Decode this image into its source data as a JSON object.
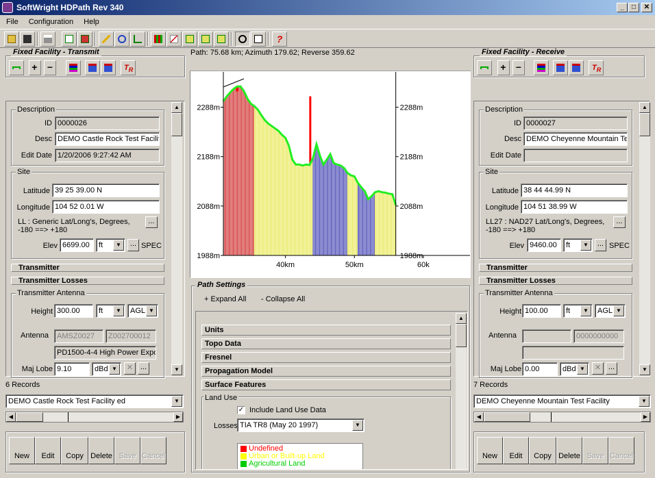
{
  "window": {
    "title": "SoftWright HDPath Rev 340"
  },
  "menu": [
    "File",
    "Configuration",
    "Help"
  ],
  "path_info": "Path: 75.68 km; Azimuth 179.62; Reverse 359.62",
  "left": {
    "frame_title": "Fixed Facility - Transmit",
    "description": {
      "label": "Description",
      "id_label": "ID",
      "id": "0000026",
      "desc_label": "Desc",
      "desc": "DEMO Castle Rock Test Facilit",
      "edit_label": "Edit Date",
      "edit_date": "1/20/2006 9:27:42 AM"
    },
    "site": {
      "label": "Site",
      "lat_label": "Latitude",
      "lat": "39 25 39.00 N",
      "lon_label": "Longitude",
      "lon": "104 52 0.01 W",
      "datum": "LL : Generic Lat/Long's, Degrees, -180 ==> +180",
      "elev_label": "Elev",
      "elev": "6699.00",
      "elev_unit": "ft",
      "spec": "SPEC"
    },
    "transmitter": "Transmitter",
    "losses": "Transmitter Losses",
    "antenna": {
      "label": "Transmitter Antenna",
      "height_label": "Height",
      "height": "300.00",
      "height_unit": "ft",
      "height_ref": "AGL",
      "ant_label": "Antenna",
      "ant1": "AMSZ0027",
      "ant2": "Z002700012",
      "ant_desc": "PD1500-4-4 High Power Expo",
      "lobe_label": "Maj Lobe",
      "lobe": "9.10",
      "lobe_unit": "dBd"
    },
    "records": "6 Records",
    "record_select": "DEMO Castle Rock Test Facility ed"
  },
  "right": {
    "frame_title": "Fixed Facility - Receive",
    "description": {
      "label": "Description",
      "id_label": "ID",
      "id": "0000027",
      "desc_label": "Desc",
      "desc": "DEMO Cheyenne Mountain Te",
      "edit_label": "Edit Date",
      "edit_date": ""
    },
    "site": {
      "label": "Site",
      "lat_label": "Latitude",
      "lat": "38 44 44.99 N",
      "lon_label": "Longitude",
      "lon": "104 51 38.99 W",
      "datum": "LL27 : NAD27 Lat/Long's, Degrees, -180 ==> +180",
      "elev_label": "Elev",
      "elev": "9460.00",
      "elev_unit": "ft",
      "spec": "SPEC"
    },
    "transmitter": "Transmitter",
    "losses": "Transmitter Losses",
    "antenna": {
      "label": "Transmitter Antenna",
      "height_label": "Height",
      "height": "100.00",
      "height_unit": "ft",
      "height_ref": "AGL",
      "ant_label": "Antenna",
      "ant1": "",
      "ant2": "0000000000",
      "ant_desc": "",
      "lobe_label": "Maj Lobe",
      "lobe": "0.00",
      "lobe_unit": "dBd"
    },
    "records": "7 Records",
    "record_select": "DEMO Cheyenne Mountain Test Facility"
  },
  "buttons": {
    "new": "New",
    "edit": "Edit",
    "copy": "Copy",
    "delete": "Delete",
    "save": "Save",
    "cancel": "Cancel"
  },
  "path_settings": {
    "title": "Path Settings",
    "expand": "+ Expand All",
    "collapse": "- Collapse All",
    "sections": [
      "Units",
      "Topo Data",
      "Fresnel",
      "Propagation Model",
      "Surface Features"
    ],
    "land_use_label": "Land Use",
    "include_label": "Include Land Use Data",
    "losses_label": "Losses",
    "losses_value": "TIA TR8 (May 20 1997)",
    "legend": [
      {
        "label": "Undefined",
        "color": "#ff0000"
      },
      {
        "label": "Urban or Built-up Land",
        "color": "#ffff00"
      },
      {
        "label": "Agricultural Land",
        "color": "#00cc00"
      }
    ]
  },
  "chart_data": {
    "type": "area",
    "y_ticks": [
      "2288m",
      "2188m",
      "2088m",
      "1988m"
    ],
    "y_tick_values": [
      2288,
      2188,
      2088,
      1988
    ],
    "x_ticks": [
      "40km",
      "50km",
      "60k"
    ],
    "x_tick_values": [
      40,
      50,
      60
    ],
    "xlim": [
      31,
      61
    ],
    "ylim": [
      1988,
      2340
    ],
    "path_end_km": 56,
    "profile": {
      "x": [
        31,
        31.5,
        32,
        32.5,
        33,
        33.5,
        34,
        34.5,
        35,
        35.5,
        36,
        36.5,
        37,
        37.5,
        38,
        38.5,
        39,
        39.5,
        40,
        40.5,
        41,
        41.5,
        42,
        42.5,
        43,
        43.5,
        44,
        44.5,
        45,
        45.5,
        46,
        46.5,
        47,
        47.5,
        48,
        48.5,
        49,
        49.5,
        50,
        50.5,
        51,
        51.5,
        52,
        52.5,
        53,
        53.5,
        54,
        54.5,
        55,
        55.5,
        56
      ],
      "y": [
        2300,
        2310,
        2318,
        2325,
        2330,
        2330,
        2320,
        2305,
        2295,
        2290,
        2283,
        2272,
        2262,
        2255,
        2250,
        2245,
        2240,
        2232,
        2226,
        2210,
        2182,
        2172,
        2172,
        2170,
        2172,
        2171,
        2185,
        2213,
        2190,
        2172,
        2182,
        2193,
        2175,
        2172,
        2170,
        2165,
        2155,
        2150,
        2148,
        2135,
        2126,
        2118,
        2102,
        2108,
        2116,
        2118,
        2116,
        2115,
        2113,
        2112,
        2090
      ]
    },
    "spikes": [
      {
        "x": 43.6,
        "y": 2310,
        "color": "#ff0000"
      },
      {
        "x": 33,
        "y": 2320,
        "color": "#ff0000"
      }
    ],
    "land_use_segments": [
      {
        "from": 31,
        "to": 35.5,
        "color": "#cc2222"
      },
      {
        "from": 35.5,
        "to": 44,
        "color": "#e8e850"
      },
      {
        "from": 44,
        "to": 49,
        "color": "#3b3bb0"
      },
      {
        "from": 49,
        "to": 50.5,
        "color": "#e8e850"
      },
      {
        "from": 50.5,
        "to": 53,
        "color": "#3b3bb0"
      },
      {
        "from": 53,
        "to": 56,
        "color": "#e8e850"
      }
    ]
  }
}
